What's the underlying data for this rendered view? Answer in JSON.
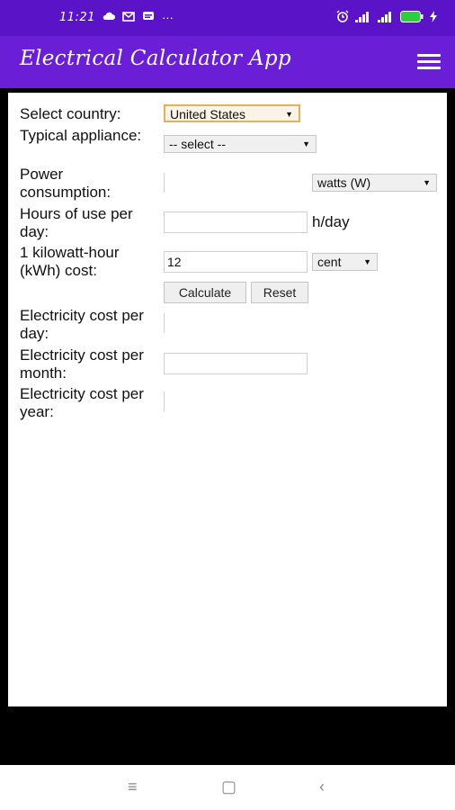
{
  "status": {
    "time": "11:21",
    "more": "···",
    "battery": "100"
  },
  "app": {
    "title": "Electrical Calculator App"
  },
  "form": {
    "country": {
      "label": "Select country:",
      "value": "United States"
    },
    "appliance": {
      "label": "Typical appliance:",
      "value": "-- select --"
    },
    "power": {
      "label": "Power consumption:",
      "value": "",
      "unit": "watts (W)"
    },
    "hours": {
      "label": "Hours of use per day:",
      "value": "",
      "suffix": "h/day"
    },
    "kwh_cost": {
      "label": "1 kilowatt-hour (kWh) cost:",
      "value": "12",
      "unit": "cent"
    },
    "buttons": {
      "calculate": "Calculate",
      "reset": "Reset"
    },
    "cost_day": {
      "label": "Electricity cost per day:",
      "value": ""
    },
    "cost_month": {
      "label": "Electricity cost per month:",
      "value": ""
    },
    "cost_year": {
      "label": "Electricity cost per year:",
      "value": ""
    }
  },
  "nav": {
    "menu": "≡",
    "home": "▢",
    "back": "‹"
  }
}
